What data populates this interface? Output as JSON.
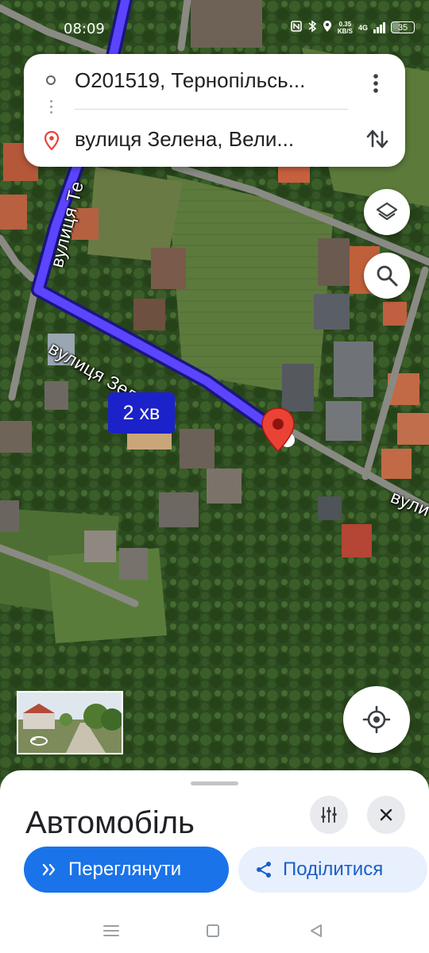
{
  "status_bar": {
    "time": "08:09",
    "net_speed_value": "0.35",
    "net_speed_unit": "KB/S",
    "network_type": "4G",
    "battery_level": "35"
  },
  "route": {
    "origin": "O201519, Тернопільсь...",
    "destination": "вулиця Зелена, Вели..."
  },
  "map": {
    "eta": "2 хв",
    "street_labels": {
      "zelena": "вулиця Зелена",
      "te": "вулиця Те",
      "vul": "вули",
      "top_fragment": "в"
    },
    "route_color": "#3d2bff",
    "destination_pin_color": "#ea4335"
  },
  "sheet": {
    "title": "Автомобіль",
    "preview_label": "Переглянути",
    "share_label": "Поділитися"
  },
  "colors": {
    "accent": "#1a73e8",
    "share_bg": "#e8f0fe"
  }
}
